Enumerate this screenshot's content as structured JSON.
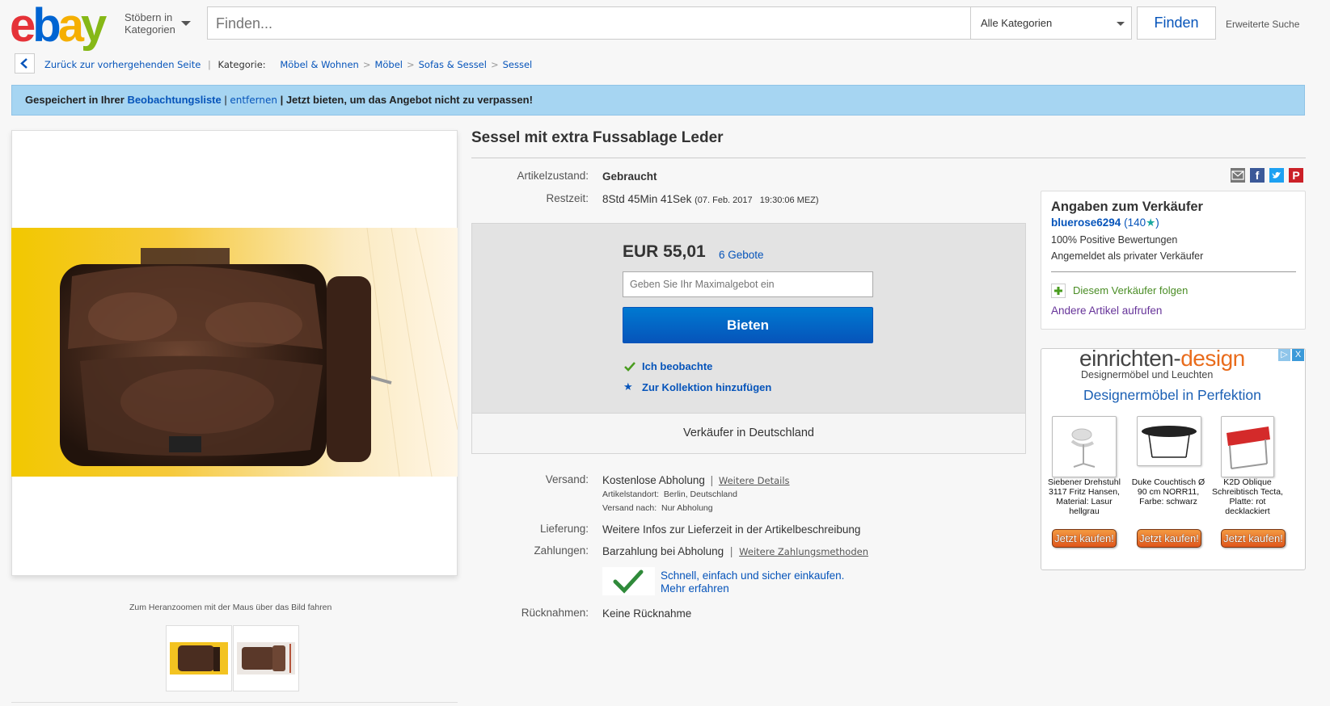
{
  "header": {
    "logo": [
      "e",
      "b",
      "a",
      "y"
    ],
    "logo_colors": [
      "#e53238",
      "#0064d2",
      "#f5af02",
      "#86b817"
    ],
    "browse_label_1": "Stöbern in",
    "browse_label_2": "Kategorien",
    "search_placeholder": "Finden...",
    "category_selected": "Alle Kategorien",
    "search_button": "Finden",
    "advanced_link": "Erweiterte Suche"
  },
  "breadcrumb": {
    "back_link": "Zurück zur vorhergehenden Seite",
    "divider": "|",
    "category_label": "Kategorie:",
    "items": [
      "Möbel & Wohnen",
      "Möbel",
      "Sofas & Sessel",
      "Sessel"
    ],
    "separator": ">"
  },
  "watch_banner": {
    "prefix": "Gespeichert in Ihrer ",
    "watchlist_link": "Beobachtungsliste",
    "pipe1": " | ",
    "remove_link": "entfernen",
    "suffix": " | Jetzt bieten, um das Angebot nicht zu verpassen!"
  },
  "gallery": {
    "zoom_hint": "Zum Heranzoomen mit der Maus über das Bild fahren",
    "thumbnail_count": 2
  },
  "item": {
    "title": "Sessel mit extra Fussablage Leder",
    "condition_label": "Artikelzustand:",
    "condition_value": "Gebraucht",
    "time_label": "Restzeit:",
    "time_value": "8Std 45Min 41Sek",
    "time_end": "(07. Feb. 2017   19:30:06 MEZ)"
  },
  "share_icons": [
    "email-icon",
    "facebook-icon",
    "twitter-icon",
    "pinterest-icon"
  ],
  "bid": {
    "price": "EUR 55,01",
    "bid_count": "6 Gebote",
    "max_bid_placeholder": "Geben Sie Ihr Maximalgebot ein",
    "bid_button": "Bieten",
    "watching": "Ich beobachte",
    "add_collection": "Zur Kollektion hinzufügen",
    "seller_location": "Verkäufer in Deutschland"
  },
  "shipping": {
    "label": "Versand:",
    "value": "Kostenlose Abholung",
    "pipe": "|",
    "details_link": "Weitere Details",
    "location_label": "Artikelstandort:",
    "location_value": "Berlin, Deutschland",
    "ship_to_label": "Versand nach:",
    "ship_to_value": "Nur Abholung"
  },
  "delivery": {
    "label": "Lieferung:",
    "value": "Weitere Infos zur Lieferzeit in der Artikelbeschreibung"
  },
  "payment": {
    "label": "Zahlungen:",
    "value": "Barzahlung bei Abholung",
    "pipe": "|",
    "more_link": "Weitere Zahlungsmethoden",
    "secure_line1": "Schnell, einfach und sicher einkaufen.",
    "secure_line2": "Mehr erfahren"
  },
  "returns": {
    "label": "Rücknahmen:",
    "value": "Keine Rücknahme"
  },
  "seller": {
    "title": "Angaben zum Verkäufer",
    "name": "bluerose6294",
    "rating_open": "(140",
    "rating_close": ")",
    "positive": "100% Positive Bewertungen",
    "type": "Angemeldet als privater Verkäufer",
    "follow": "Diesem Verkäufer folgen",
    "other_items": "Andere Artikel aufrufen"
  },
  "ad": {
    "brand_1": "einrichten-",
    "brand_2": "design",
    "brand_sub": "Designermöbel und Leuchten",
    "headline": "Designermöbel in Perfektion",
    "close": "X",
    "products": [
      {
        "caption": "Siebener Drehstuhl 3117 Fritz Hansen, Material: Lasur hellgrau",
        "button": "Jetzt kaufen!"
      },
      {
        "caption": "Duke Couchtisch Ø 90 cm NORR11, Farbe: schwarz",
        "button": "Jetzt kaufen!"
      },
      {
        "caption": "K2D Oblique Schreibtisch Tecta, Platte: rot decklackiert",
        "button": "Jetzt kaufen!"
      }
    ]
  },
  "colors": {
    "link": "#0654ba",
    "banner": "#a6d5f2",
    "bid_button": "#0654ba",
    "ad_button": "#e0561b"
  }
}
